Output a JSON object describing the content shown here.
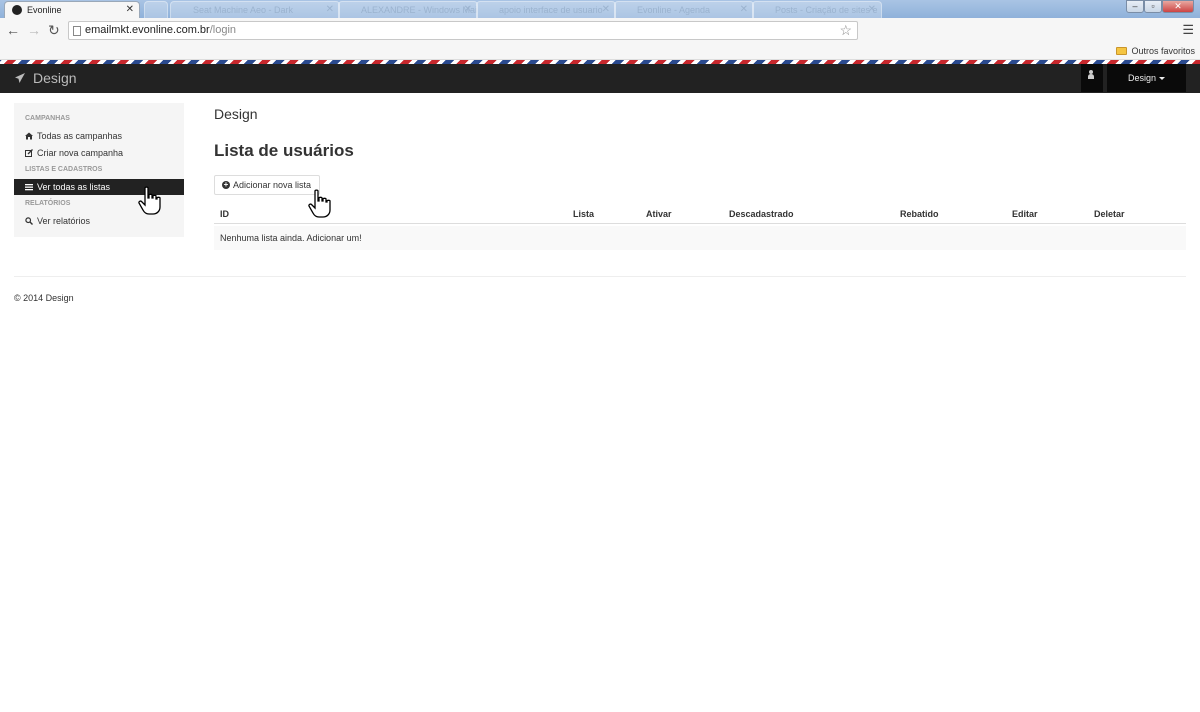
{
  "browser": {
    "active_tab_title": "Evonline",
    "background_tabs": [
      {
        "title": "Seat Machine Aeo - Dark"
      },
      {
        "title": "ALEXANDRE - Windows Mail"
      },
      {
        "title": "apoio interface de usuario"
      },
      {
        "title": "Evonline - Agenda"
      },
      {
        "title": "Posts - Criação de sites e"
      }
    ],
    "url_host": "emailmkt.evonline.com.br",
    "url_path": "/login",
    "bookmark_folder": "Outros favoritos"
  },
  "navbar": {
    "brand": "Design",
    "user_menu": "Design"
  },
  "sidebar": {
    "sections": [
      {
        "header": "CAMPANHAS",
        "items": [
          "Todas as campanhas",
          "Criar nova campanha"
        ]
      },
      {
        "header": "LISTAS E CADASTROS",
        "items": [
          "Ver todas as listas"
        ]
      },
      {
        "header": "RELATÓRIOS",
        "items": [
          "Ver relatórios"
        ]
      }
    ],
    "active_item": "Ver todas as listas"
  },
  "main": {
    "section_title": "Design",
    "page_title": "Lista de usuários",
    "add_button": "Adicionar nova lista",
    "table": {
      "columns": [
        "ID",
        "Lista",
        "Ativar",
        "Descadastrado",
        "Rebatido",
        "Editar",
        "Deletar"
      ],
      "empty_message": "Nenhuma lista ainda. Adicionar um!"
    }
  },
  "footer": {
    "text": "© 2014 Design"
  },
  "colors": {
    "navbar_bg": "#222222",
    "sidebar_bg": "#f5f5f5",
    "active_item_bg": "#222222"
  },
  "icons": {
    "brand": "paper-plane-icon",
    "user": "user-icon",
    "campaigns": "home-icon",
    "new_campaign": "edit-icon",
    "lists": "list-icon",
    "reports": "search-icon",
    "add": "plus-circle-icon"
  }
}
